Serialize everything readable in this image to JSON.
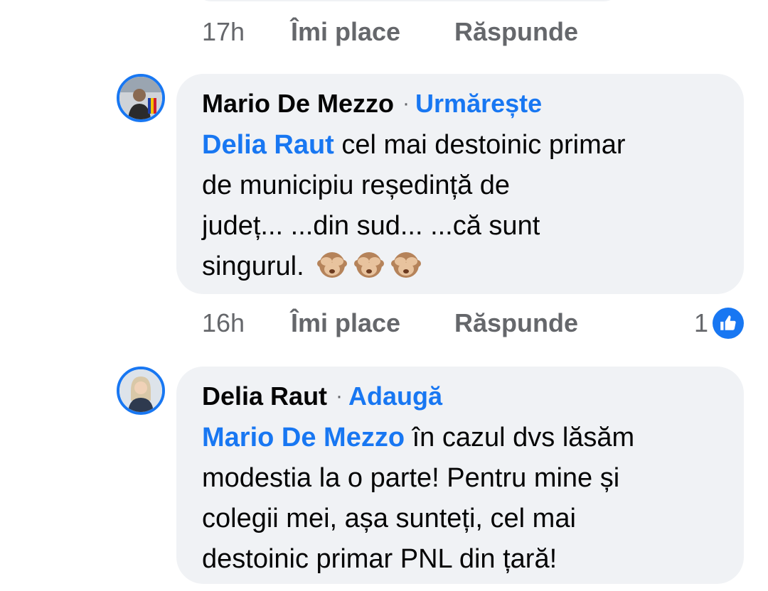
{
  "comments": [
    {
      "meta": {
        "time": "17h",
        "like_label": "Îmi place",
        "reply_label": "Răspunde"
      }
    },
    {
      "author": "Mario De Mezzo",
      "separator": "·",
      "action_label": "Urmărește",
      "mention": "Delia Raut",
      "text_line1": " cel mai destoinic primar",
      "text_line2": "de municipiu reședință de",
      "text_line3": "județ... ...din sud... ...că sunt",
      "text_line4": "singurul.",
      "emoji_name": "see-no-evil-monkey-icon",
      "meta": {
        "time": "16h",
        "like_label": "Îmi place",
        "reply_label": "Răspunde"
      },
      "reaction_count": "1",
      "reaction_icon": "like-icon"
    },
    {
      "author": "Delia Raut",
      "separator": "·",
      "action_label": "Adaugă",
      "mention": "Mario De Mezzo",
      "text_line1": " în cazul dvs lăsăm",
      "text_line2": "modestia la o parte! Pentru mine și",
      "text_line3": "colegii mei, așa sunteți, cel mai",
      "text_line4": "destoinic primar PNL din țară!"
    }
  ],
  "colors": {
    "accent": "#1877f2",
    "bubble": "#f0f2f5",
    "meta_text": "#65676b",
    "text": "#050505"
  }
}
